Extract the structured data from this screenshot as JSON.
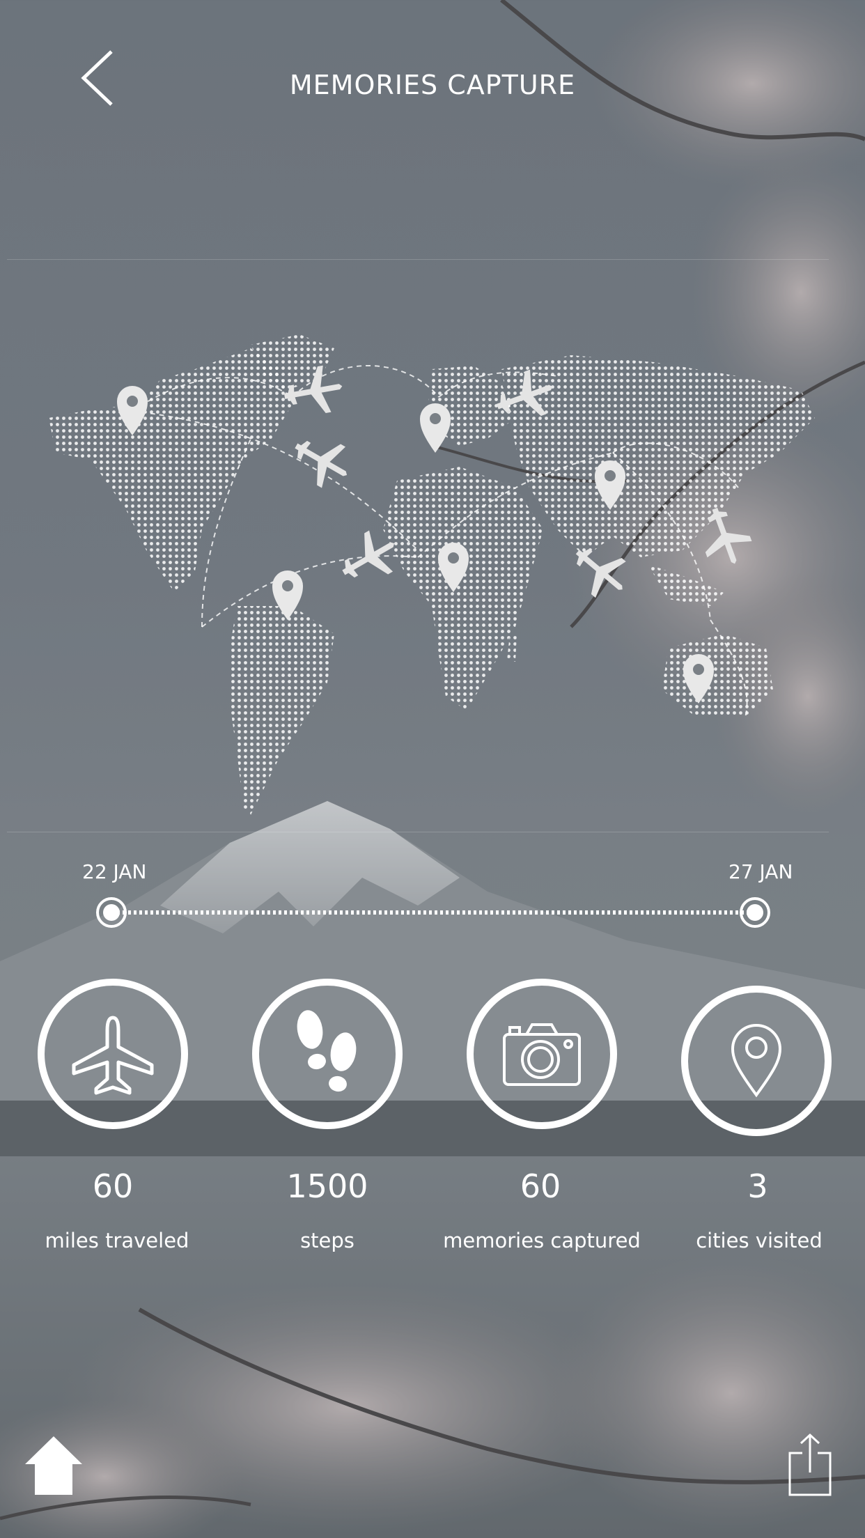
{
  "header": {
    "title": "MEMORIES CAPTURE",
    "back_icon": "chevron-left-icon"
  },
  "map": {
    "icons": [
      "world-map-icon",
      "location-pin-icon",
      "airplane-icon"
    ]
  },
  "timeline": {
    "start_label": "22 JAN",
    "end_label": "27 JAN"
  },
  "stats": [
    {
      "icon": "airplane-icon",
      "value": "60",
      "label": "miles traveled"
    },
    {
      "icon": "footsteps-icon",
      "value": "1500",
      "label": "steps"
    },
    {
      "icon": "camera-icon",
      "value": "60",
      "label": "memories captured"
    },
    {
      "icon": "location-pin-icon",
      "value": "3",
      "label": "cities visited"
    }
  ],
  "footer": {
    "home_icon": "home-icon",
    "share_icon": "share-icon"
  },
  "colors": {
    "overlay": "#737a82",
    "foreground": "#ffffff"
  }
}
